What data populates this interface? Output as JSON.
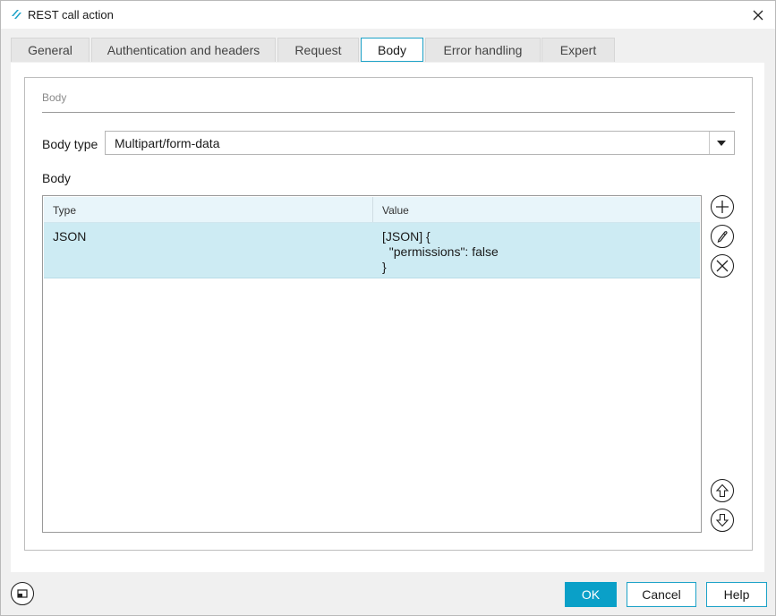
{
  "window": {
    "title": "REST call action"
  },
  "tabs": [
    {
      "label": "General"
    },
    {
      "label": "Authentication and headers"
    },
    {
      "label": "Request"
    },
    {
      "label": "Body",
      "active": true
    },
    {
      "label": "Error handling"
    },
    {
      "label": "Expert"
    }
  ],
  "body_section": {
    "title": "Body",
    "body_type_label": "Body type",
    "body_type_value": "Multipart/form-data",
    "body_label": "Body"
  },
  "grid": {
    "columns": [
      "Type",
      "Value"
    ],
    "rows": [
      {
        "type": "JSON",
        "value": "[JSON] {\n  \"permissions\": false\n}"
      }
    ]
  },
  "side_buttons": [
    "plus-icon",
    "pencil-icon",
    "cross-icon",
    "arrow-up-icon",
    "arrow-down-icon"
  ],
  "footer": {
    "ok_label": "OK",
    "cancel_label": "Cancel",
    "help_label": "Help"
  },
  "colors": {
    "accent": "#0aa0c8",
    "selected_row": "#cdebf3",
    "header_row": "#e8f5fa"
  }
}
